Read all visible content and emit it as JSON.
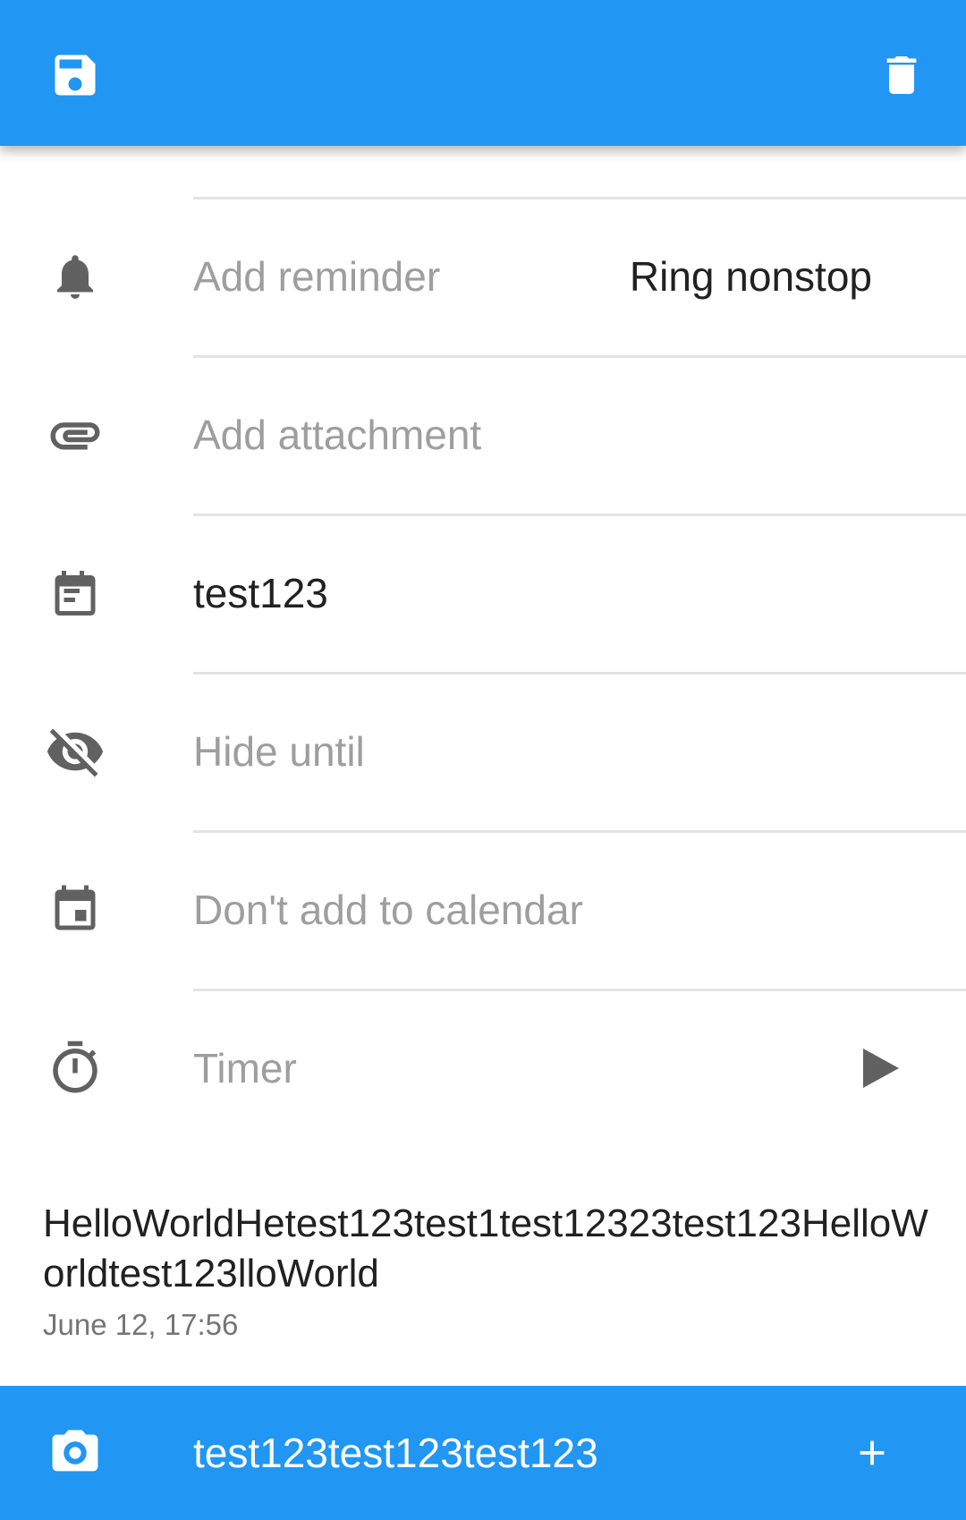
{
  "toolbar": {
    "save_icon": "save-icon",
    "delete_icon": "delete-icon",
    "color": "#2196F3"
  },
  "rows": {
    "reminder": {
      "icon": "bell-icon",
      "label": "Add reminder",
      "mode": "Ring nonstop"
    },
    "attachment": {
      "icon": "paperclip-icon",
      "label": "Add attachment"
    },
    "list": {
      "icon": "list-calendar-icon",
      "label": "test123"
    },
    "hide_until": {
      "icon": "eye-off-icon",
      "label": "Hide until"
    },
    "calendar": {
      "icon": "calendar-icon",
      "label": "Don't add to calendar"
    },
    "timer": {
      "icon": "stopwatch-icon",
      "label": "Timer",
      "action_icon": "play-icon"
    }
  },
  "comment": {
    "text": "HelloWorldHetest123test1test12323test123HelloWorldtest123lloWorld",
    "date": "June 12, 17:56"
  },
  "bottom_bar": {
    "camera_icon": "camera-icon",
    "comment_input": "test123test123test123",
    "add_icon": "plus-icon"
  }
}
